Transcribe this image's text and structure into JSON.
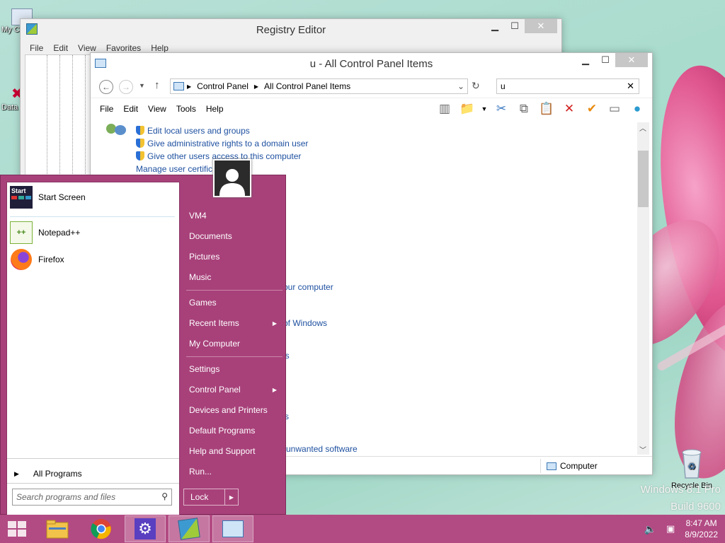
{
  "desktop": {
    "icons": [
      {
        "label": "My C"
      },
      {
        "label": "Data"
      },
      {
        "label": "Recycle Bin"
      }
    ],
    "watermark": {
      "line1": "Windows 8.1 Pro",
      "line2": "Build 9600"
    }
  },
  "regedit": {
    "title": "Registry Editor",
    "menu": [
      "File",
      "Edit",
      "View",
      "Favorites",
      "Help"
    ]
  },
  "cpanel": {
    "title": "u - All Control Panel Items",
    "breadcrumb": [
      "Control Panel",
      "All Control Panel Items"
    ],
    "search_value": "u",
    "menu": [
      "File",
      "Edit",
      "View",
      "Tools",
      "Help"
    ],
    "links": [
      "Edit local users and groups",
      "Give administrative rights to a domain user",
      "Give other users access to this computer",
      "Manage user certific",
      "our computer",
      "ns of Windows",
      "gs",
      "s",
      "unwanted software"
    ],
    "status_computer": "Computer"
  },
  "startmenu": {
    "pinned": [
      {
        "label": "Start Screen",
        "icon": "start-screen-icon"
      },
      {
        "label": "Notepad++",
        "icon": "notepad-plus-plus-icon"
      },
      {
        "label": "Firefox",
        "icon": "firefox-icon"
      }
    ],
    "start_icon_text": "Start",
    "all_programs": "All Programs",
    "search_placeholder": "Search programs and files",
    "right_items": [
      "VM4",
      "Documents",
      "Pictures",
      "Music",
      "Games",
      "Recent Items",
      "My Computer",
      "Settings",
      "Control Panel",
      "Devices and Printers",
      "Default Programs",
      "Help and Support",
      "Run..."
    ],
    "lock_label": "Lock"
  },
  "taskbar": {
    "time": "8:47 AM",
    "date": "8/9/2022"
  },
  "colors": {
    "startmenu_bg": "#a8417a",
    "taskbar_bg": "#b24a83",
    "link_color": "#1e50a0"
  }
}
